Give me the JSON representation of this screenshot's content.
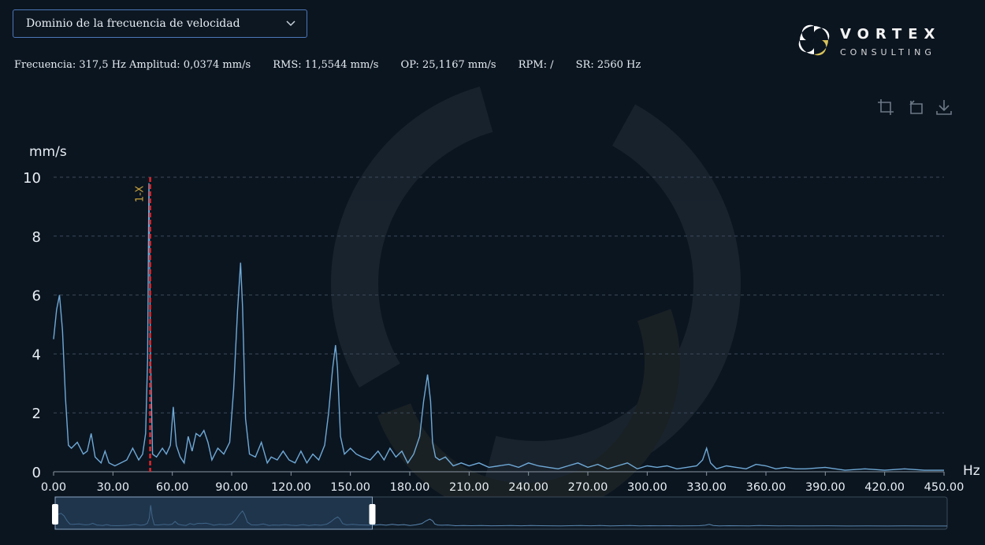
{
  "selector": {
    "value": "Dominio de la frecuencia de velocidad",
    "icon": "chevron-down-icon"
  },
  "stats": {
    "frequency_amplitude": "Frecuencia: 317,5 Hz Amplitud: 0,0374 mm/s",
    "rms": "RMS: 11,5544 mm/s",
    "op": "OP: 25,1167 mm/s",
    "rpm": "RPM: /",
    "sr": "SR: 2560 Hz"
  },
  "brand": {
    "name": "VORTEX",
    "tagline": "CONSULTING",
    "accent": "#d9c35a"
  },
  "toolbox": [
    {
      "name": "zoom-select-icon"
    },
    {
      "name": "zoom-reset-icon"
    },
    {
      "name": "download-icon"
    }
  ],
  "colors": {
    "line": "#6fa9d6",
    "marker": "#e3262b",
    "marker_label": "#c9a23a",
    "grid": "#3c4a5a",
    "axis_text": "#e8eef3"
  },
  "chart_data": {
    "type": "line",
    "ylabel": "mm/s",
    "xlabel": "Hz",
    "ylim": [
      0,
      10
    ],
    "xlim": [
      0,
      450
    ],
    "yticks": [
      0,
      2,
      4,
      6,
      8,
      10
    ],
    "xticks": [
      "0.00",
      "30.00",
      "60.00",
      "90.00",
      "120.00",
      "150.00",
      "180.00",
      "210.00",
      "240.00",
      "270.00",
      "300.00",
      "330.00",
      "360.00",
      "390.00",
      "420.00",
      "450.00"
    ],
    "grid": true,
    "marker": {
      "label": "1-X",
      "x": 48.8
    },
    "series": [
      {
        "x": [
          0,
          1.5,
          3,
          4.5,
          6,
          7.5,
          9,
          12,
          15,
          17,
          19,
          21,
          24,
          26,
          28,
          31,
          34,
          37,
          40,
          43,
          45,
          46.5,
          47.5,
          48.2,
          49,
          50,
          52,
          55,
          57,
          59,
          60.5,
          62,
          64,
          66,
          68,
          70,
          72,
          74,
          76,
          78,
          80,
          83,
          86,
          89,
          91,
          93,
          94.5,
          95.5,
          97,
          99,
          102,
          105,
          108,
          110,
          113,
          116,
          119,
          122,
          125,
          128,
          131,
          134,
          137,
          139,
          141,
          142.5,
          143.5,
          145,
          147,
          150,
          153,
          156,
          160,
          164,
          167,
          170,
          173,
          176,
          179,
          182,
          185,
          187,
          189,
          190.5,
          191.5,
          193,
          195,
          198,
          202,
          206,
          210,
          215,
          220,
          225,
          230,
          235,
          240,
          245,
          250,
          255,
          260,
          265,
          270,
          275,
          280,
          285,
          290,
          295,
          300,
          305,
          310,
          315,
          320,
          325,
          328,
          330,
          332,
          335,
          340,
          345,
          350,
          355,
          360,
          365,
          370,
          375,
          380,
          390,
          400,
          410,
          420,
          430,
          440,
          450
        ],
        "values": [
          4.5,
          5.5,
          6.0,
          4.8,
          2.5,
          0.9,
          0.8,
          1.0,
          0.6,
          0.7,
          1.3,
          0.5,
          0.3,
          0.7,
          0.3,
          0.2,
          0.3,
          0.4,
          0.8,
          0.4,
          0.6,
          1.3,
          3.8,
          9.8,
          4.0,
          0.6,
          0.5,
          0.8,
          0.6,
          0.9,
          2.2,
          0.9,
          0.5,
          0.3,
          1.2,
          0.7,
          1.3,
          1.2,
          1.4,
          1.0,
          0.4,
          0.8,
          0.6,
          1.0,
          2.8,
          5.5,
          7.1,
          5.6,
          1.8,
          0.6,
          0.5,
          1.0,
          0.3,
          0.5,
          0.4,
          0.7,
          0.4,
          0.3,
          0.7,
          0.3,
          0.6,
          0.4,
          0.9,
          2.0,
          3.5,
          4.3,
          3.5,
          1.2,
          0.6,
          0.8,
          0.6,
          0.5,
          0.4,
          0.7,
          0.4,
          0.8,
          0.5,
          0.7,
          0.3,
          0.6,
          1.2,
          2.4,
          3.3,
          2.4,
          1.0,
          0.5,
          0.4,
          0.5,
          0.2,
          0.3,
          0.2,
          0.3,
          0.15,
          0.2,
          0.25,
          0.15,
          0.3,
          0.2,
          0.15,
          0.1,
          0.2,
          0.3,
          0.15,
          0.25,
          0.1,
          0.2,
          0.3,
          0.1,
          0.2,
          0.15,
          0.2,
          0.1,
          0.15,
          0.2,
          0.4,
          0.8,
          0.3,
          0.1,
          0.2,
          0.15,
          0.1,
          0.25,
          0.2,
          0.1,
          0.15,
          0.1,
          0.1,
          0.15,
          0.05,
          0.1,
          0.05,
          0.1,
          0.05,
          0.05
        ]
      }
    ]
  },
  "slider": {
    "range_start_hz": 0,
    "range_end_hz": 160,
    "total_hz": 450
  }
}
